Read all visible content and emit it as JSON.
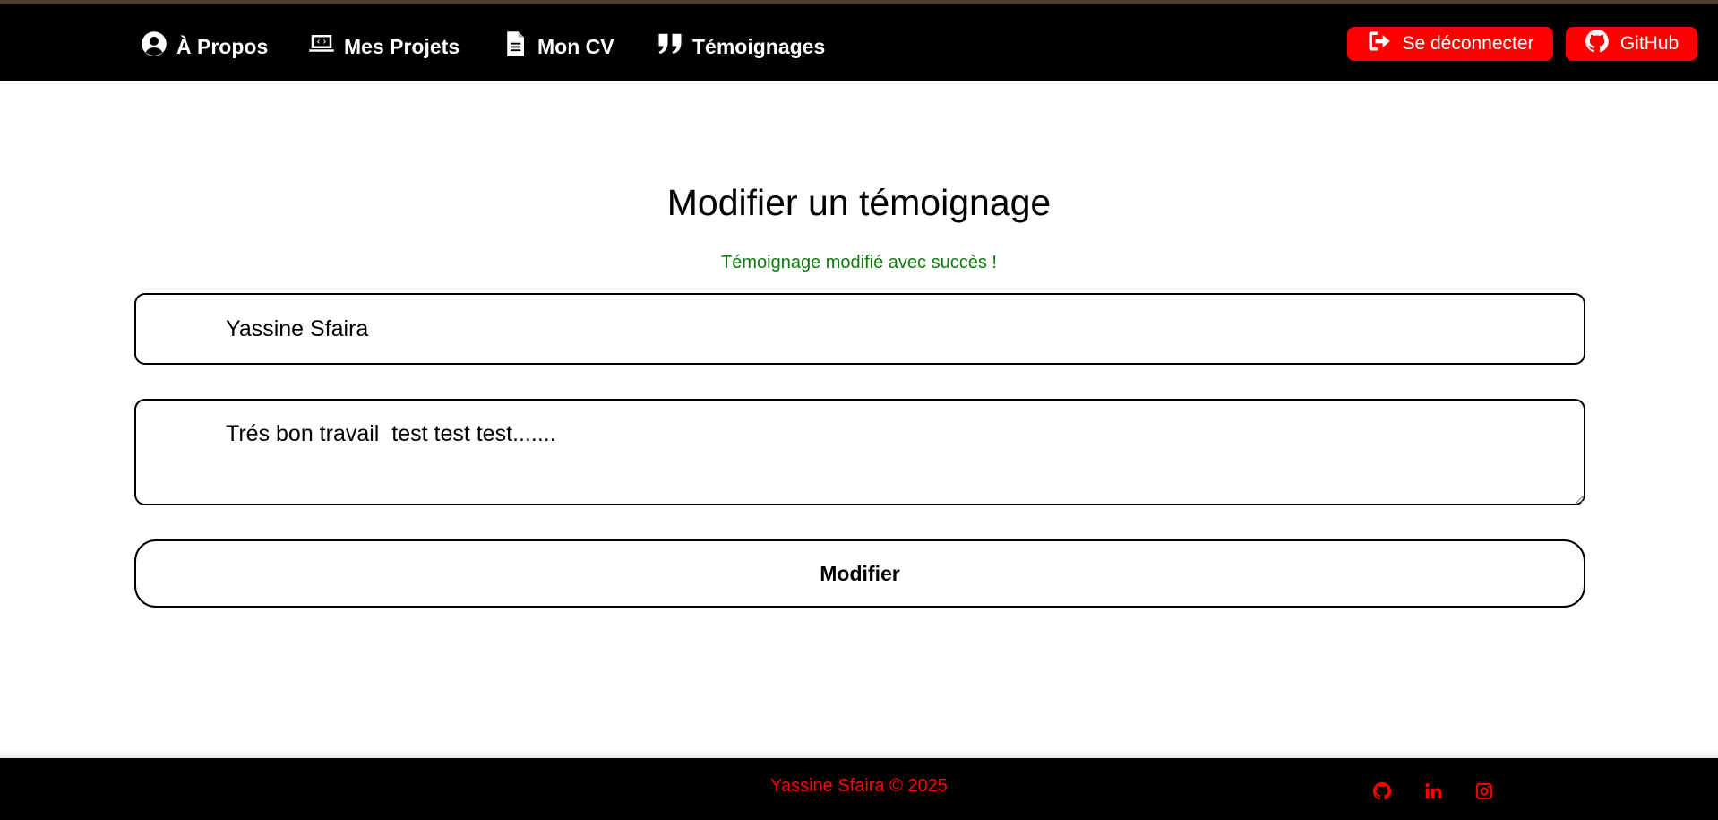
{
  "nav": {
    "items": [
      {
        "label": "À Propos",
        "icon": "user-circle-icon"
      },
      {
        "label": "Mes Projets",
        "icon": "laptop-code-icon"
      },
      {
        "label": "Mon CV",
        "icon": "file-icon"
      },
      {
        "label": "Témoignages",
        "icon": "quote-icon"
      }
    ],
    "logout_label": "Se déconnecter",
    "github_label": "GitHub"
  },
  "main": {
    "title": "Modifier un témoignage",
    "success_message": "Témoignage modifié avec succès !",
    "name_value": "Yassine Sfaira",
    "message_value": "Trés bon travail  test test test.......",
    "submit_label": "Modifier"
  },
  "footer": {
    "copyright": "Yassine Sfaira © 2025",
    "social_icons": [
      "github-icon",
      "linkedin-icon",
      "instagram-icon"
    ]
  },
  "colors": {
    "nav_bg": "#000000",
    "accent": "#ff0000",
    "success": "#0f7a0f"
  }
}
